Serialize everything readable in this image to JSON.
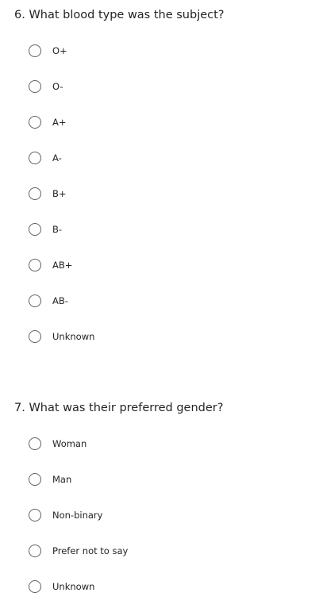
{
  "questions": [
    {
      "title": "6. What blood type was the subject?",
      "options": [
        "O+",
        "O-",
        "A+",
        "A-",
        "B+",
        "B-",
        "AB+",
        "AB-",
        "Unknown"
      ]
    },
    {
      "title": "7. What was their preferred gender?",
      "options": [
        "Woman",
        "Man",
        "Non-binary",
        "Prefer not to say",
        "Unknown"
      ]
    }
  ]
}
